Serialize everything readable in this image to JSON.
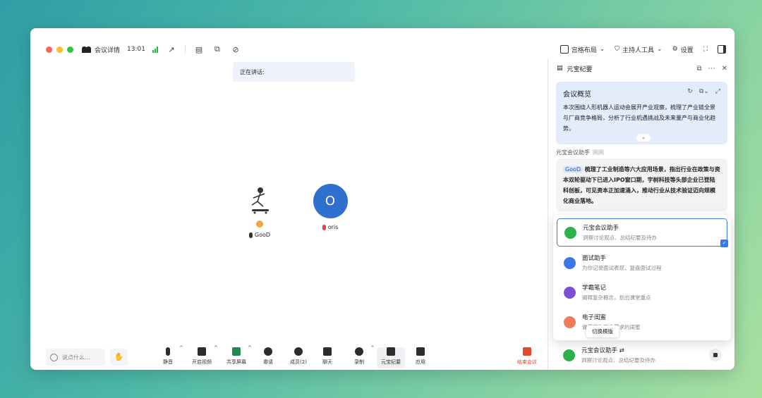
{
  "titlebar": {
    "meeting_details": "会议详情",
    "time": "13:01",
    "grid_layout": "宫格布局",
    "host_tools": "主持人工具",
    "settings": "设置"
  },
  "stage": {
    "speaking_label": "正在讲话:",
    "participants": [
      {
        "name": "GooD",
        "mic": "on"
      },
      {
        "name": "oris",
        "avatar_letter": "O",
        "mic": "muted"
      }
    ]
  },
  "toolbar": {
    "say_placeholder": "说点什么...",
    "mute": "静音",
    "start_video": "开启视频",
    "share_screen": "共享屏幕",
    "invite": "邀请",
    "members": "成员(2)",
    "chat": "聊天",
    "record": "录制",
    "yuanbao_notes": "元宝纪要",
    "apps": "应用",
    "end_meeting": "结束会议"
  },
  "panel": {
    "title": "元宝纪要",
    "overview_title": "会议概览",
    "overview_text": "本次围绕人形机器人运动会展开产业观察，梳理了产业链全景与厂商竞争格局，分析了行业机遇挑战及未来量产与商业化趋势。",
    "assistant_label": "元宝会议助手",
    "assistant_time": "刚刚",
    "assistant_tag": "GooD",
    "assistant_text": "梳理了工业制造等六大应用场景，指出行业在政策与资本双轮驱动下已进入IPO窗口期，宇树科技等头部企业已登陆科创板，可见资本正加速涌入，推动行业从技术验证迈向规模化商业落地。"
  },
  "templates": [
    {
      "name": "元宝会议助手",
      "desc": "洞察讨论观点、总结纪要及待办",
      "selected": true,
      "color": "#2bb24c"
    },
    {
      "name": "面试助手",
      "desc": "为你记录面试表现，复盘面试过程",
      "selected": false,
      "color": "#3b78e7"
    },
    {
      "name": "学霸笔记",
      "desc": "阐释复杂概念，划出课堂重点",
      "selected": false,
      "color": "#7a4fd6"
    },
    {
      "name": "电子闺蜜",
      "desc": "做最懂你开会需求的闺蜜",
      "selected": false,
      "color": "#f07a5a"
    }
  ],
  "tooltip": "切换模版",
  "footer": {
    "name": "元宝会议助手",
    "desc": "洞察讨论观点、总结纪要及待办"
  }
}
